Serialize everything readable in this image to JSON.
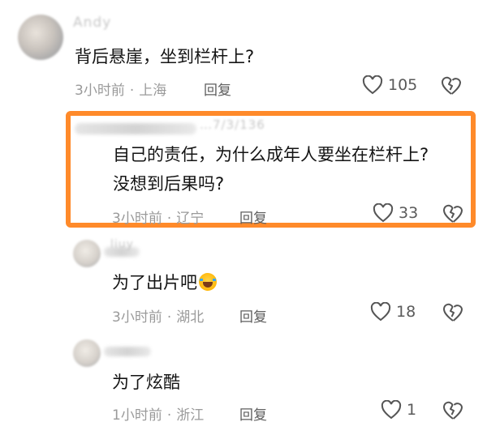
{
  "comments": [
    {
      "username": "Andy",
      "text_lines": [
        "背后悬崖，坐到栏杆上?"
      ],
      "time": "3小时前",
      "location": "上海",
      "reply_label": "回复",
      "likes": "105"
    },
    {
      "username": "…7/3/136",
      "text_lines": [
        "自己的责任，为什么成年人要坐在栏杆上?",
        "没想到后果吗?"
      ],
      "time": "3小时前",
      "location": "辽宁",
      "reply_label": "回复",
      "likes": "33"
    },
    {
      "username": "liuy",
      "text_lines": [
        "为了出片吧"
      ],
      "emoji": "rolling-laughing-emoji",
      "time": "3小时前",
      "location": "湖北",
      "reply_label": "回复",
      "likes": "18"
    },
    {
      "username": "",
      "text_lines": [
        "为了炫酷"
      ],
      "time": "1小时前",
      "location": "浙江",
      "reply_label": "回复",
      "likes": "1"
    }
  ],
  "meta_separator": "·",
  "colors": {
    "highlight_border": "#ff8a2a",
    "meta_text": "#9a9a9a"
  },
  "icons": {
    "like": "heart-outline-icon",
    "dislike": "broken-heart-icon"
  }
}
